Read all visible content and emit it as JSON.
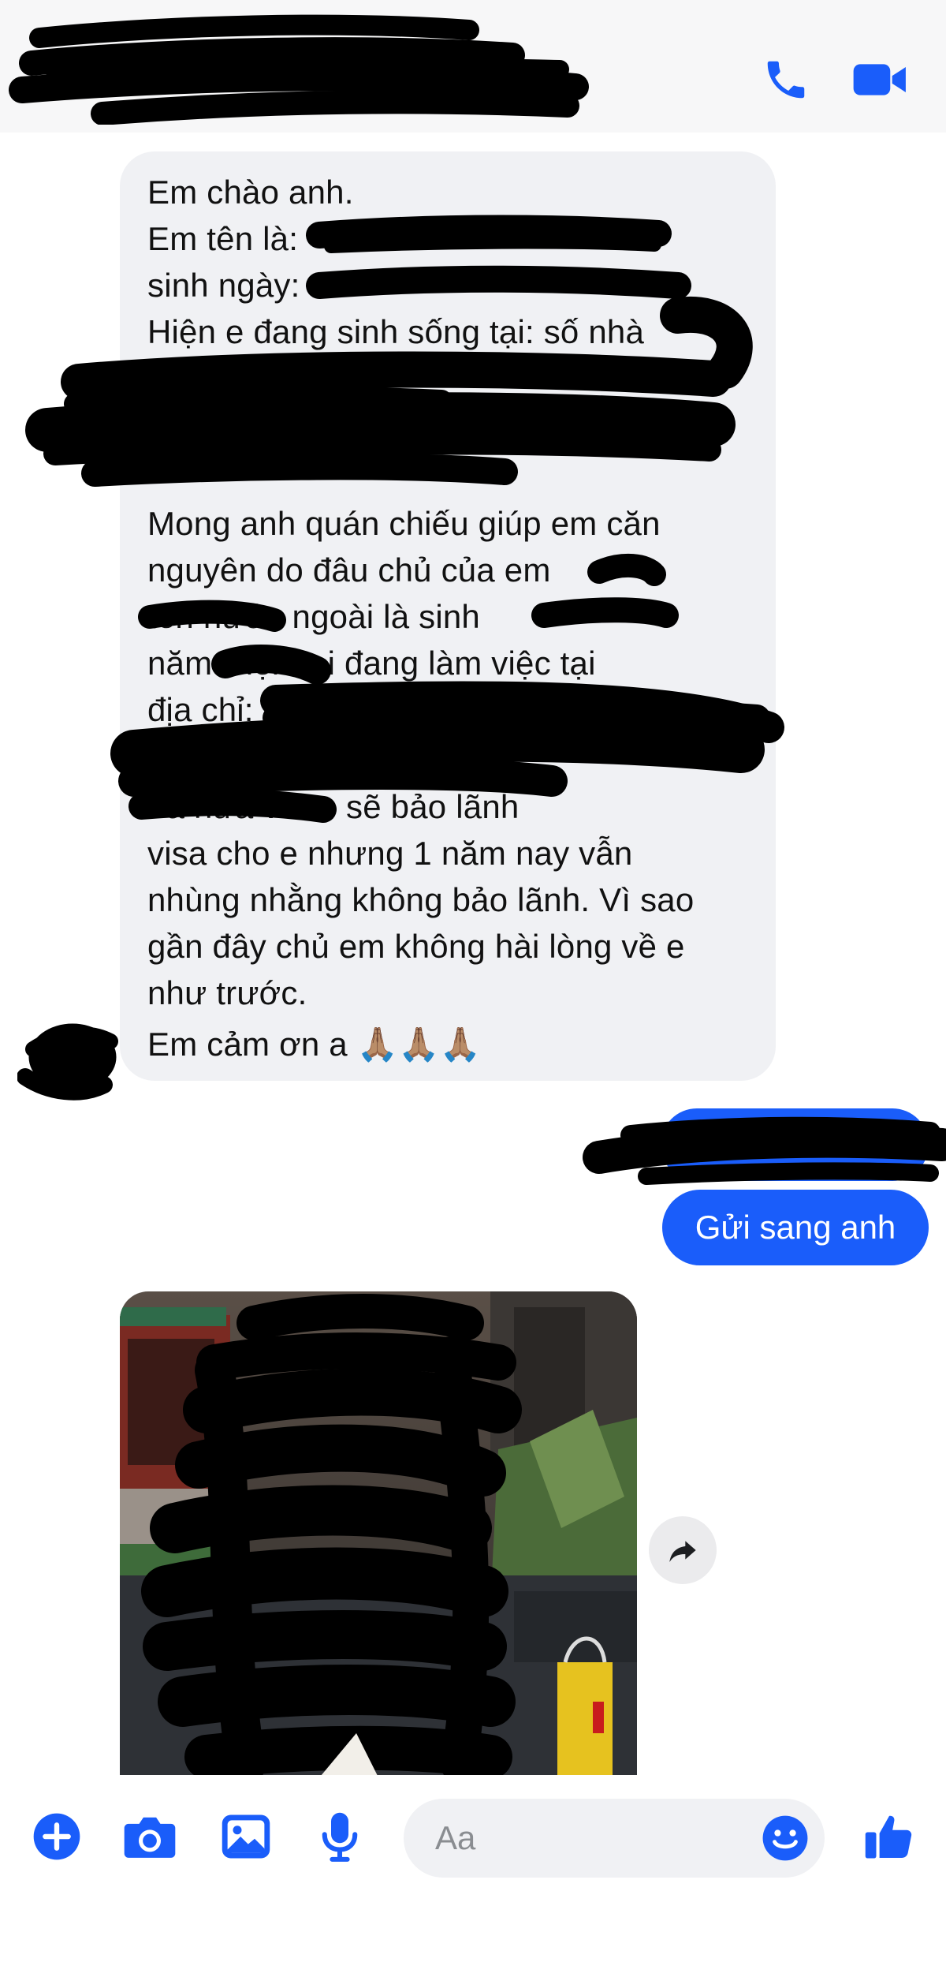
{
  "chat": {
    "incoming_lines": [
      "Em chào anh.",
      "Em tên là: ",
      "sinh ngày:",
      "Hiện e đang sinh sống tại: số nhà",
      "",
      "",
      "",
      "Mong anh quán chiếu giúp em căn",
      "nguyên do đâu chủ của em",
      "              tên nước ngoài là         sinh",
      "năm          Hiện tại đang làm việc tại",
      "địa chỉ:",
      "",
      "             đã hứa với e sẽ bảo lãnh",
      "visa cho e nhưng 1 năm nay vẫn",
      "nhùng nhằng không bảo lãnh. Vì sao",
      "gần đây chủ em không hài lòng về e",
      "như trước.",
      "Em cảm ơn a 🙏🏽🙏🏽🙏🏽"
    ],
    "outgoing_reply": "Gửi sang anh"
  },
  "composer": {
    "placeholder": "Aa"
  },
  "colors": {
    "accent": "#1a5dfa",
    "incoming_bubble": "#f0f1f4",
    "header_bg": "#f7f7f8",
    "redaction": "#000000"
  },
  "icons": {
    "header": [
      "phone-icon",
      "video-camera-icon"
    ],
    "composer": [
      "plus-icon",
      "camera-icon",
      "image-icon",
      "microphone-icon",
      "emoji-icon",
      "thumbs-up-icon"
    ],
    "message": [
      "forward-icon"
    ]
  }
}
